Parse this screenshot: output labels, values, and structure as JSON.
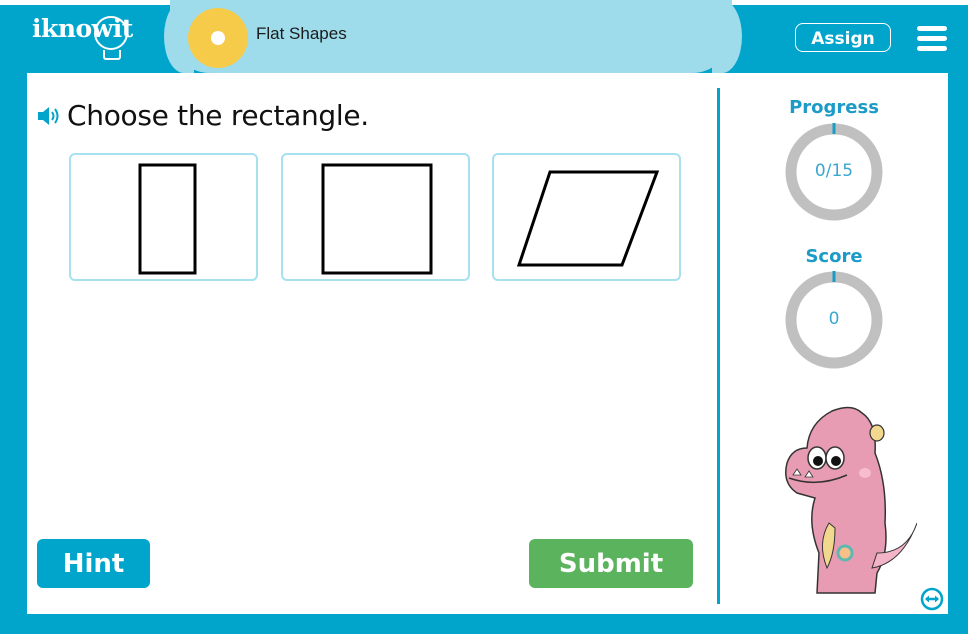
{
  "header": {
    "logo_text": "iknowit",
    "topic_title": "Flat Shapes",
    "assign_label": "Assign",
    "menu_icon": "hamburger-menu-icon"
  },
  "question": {
    "speaker_icon": "speaker-icon",
    "text": "Choose the rectangle."
  },
  "choices": [
    {
      "shape": "tall rectangle"
    },
    {
      "shape": "square"
    },
    {
      "shape": "parallelogram"
    }
  ],
  "sidebar": {
    "progress_label": "Progress",
    "progress_value": "0/15",
    "progress_fraction": 0,
    "score_label": "Score",
    "score_value": "0",
    "mascot": "pink-monster-mascot",
    "expand_icon": "expand-horizontal-icon"
  },
  "buttons": {
    "hint_label": "Hint",
    "submit_label": "Submit"
  },
  "colors": {
    "brand_blue": "#01a4cb",
    "pill_light_blue": "#9edcec",
    "topic_yellow": "#f6cb4a",
    "submit_green": "#5cb35e",
    "ring_gray": "#c0c0c0"
  }
}
